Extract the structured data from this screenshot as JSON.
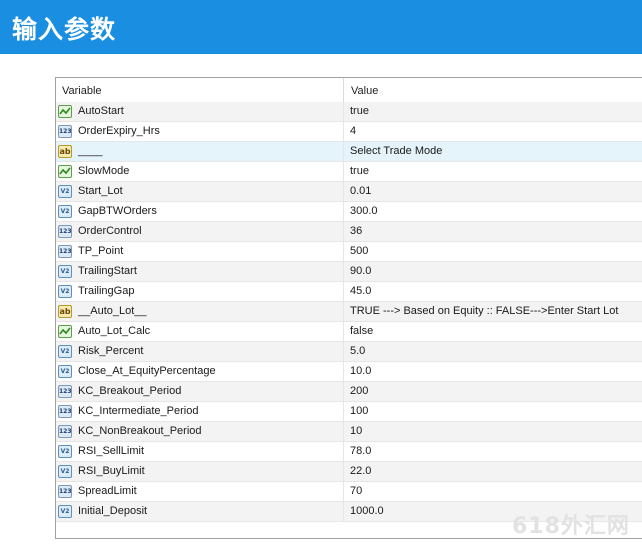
{
  "banner": {
    "title": "输入参数"
  },
  "table": {
    "columns": [
      "Variable",
      "Value"
    ],
    "rows": [
      {
        "type": "bool",
        "icon": "bool-icon",
        "name": "AutoStart",
        "value": "true"
      },
      {
        "type": "int",
        "icon": "int-icon",
        "name": "OrderExpiry_Hrs",
        "value": "4"
      },
      {
        "type": "str",
        "icon": "string-icon",
        "name": "____",
        "value": "Select Trade Mode"
      },
      {
        "type": "bool",
        "icon": "bool-icon",
        "name": "SlowMode",
        "value": "true"
      },
      {
        "type": "dbl",
        "icon": "double-icon",
        "name": "Start_Lot",
        "value": "0.01"
      },
      {
        "type": "dbl",
        "icon": "double-icon",
        "name": "GapBTWOrders",
        "value": "300.0"
      },
      {
        "type": "int",
        "icon": "int-icon",
        "name": "OrderControl",
        "value": "36"
      },
      {
        "type": "int",
        "icon": "int-icon",
        "name": "TP_Point",
        "value": "500"
      },
      {
        "type": "dbl",
        "icon": "double-icon",
        "name": "TrailingStart",
        "value": "90.0"
      },
      {
        "type": "dbl",
        "icon": "double-icon",
        "name": "TrailingGap",
        "value": "45.0"
      },
      {
        "type": "str",
        "icon": "string-icon",
        "name": "__Auto_Lot__",
        "value": "TRUE ---> Based on Equity ::  FALSE--->Enter Start Lot"
      },
      {
        "type": "bool",
        "icon": "bool-icon",
        "name": "Auto_Lot_Calc",
        "value": "false"
      },
      {
        "type": "dbl",
        "icon": "double-icon",
        "name": "Risk_Percent",
        "value": "5.0"
      },
      {
        "type": "dbl",
        "icon": "double-icon",
        "name": "Close_At_EquityPercentage",
        "value": "10.0"
      },
      {
        "type": "int",
        "icon": "int-icon",
        "name": "KC_Breakout_Period",
        "value": "200"
      },
      {
        "type": "int",
        "icon": "int-icon",
        "name": "KC_Intermediate_Period",
        "value": "100"
      },
      {
        "type": "int",
        "icon": "int-icon",
        "name": "KC_NonBreakout_Period",
        "value": "10"
      },
      {
        "type": "dbl",
        "icon": "double-icon",
        "name": "RSI_SellLimit",
        "value": "78.0"
      },
      {
        "type": "dbl",
        "icon": "double-icon",
        "name": "RSI_BuyLimit",
        "value": "22.0"
      },
      {
        "type": "int",
        "icon": "int-icon",
        "name": "SpreadLimit",
        "value": "70"
      },
      {
        "type": "dbl",
        "icon": "double-icon",
        "name": "Initial_Deposit",
        "value": "1000.0"
      }
    ]
  },
  "icon_labels": {
    "int": "123",
    "dbl": "V2",
    "str": "ab",
    "bool": ""
  },
  "watermark": "618外汇网"
}
